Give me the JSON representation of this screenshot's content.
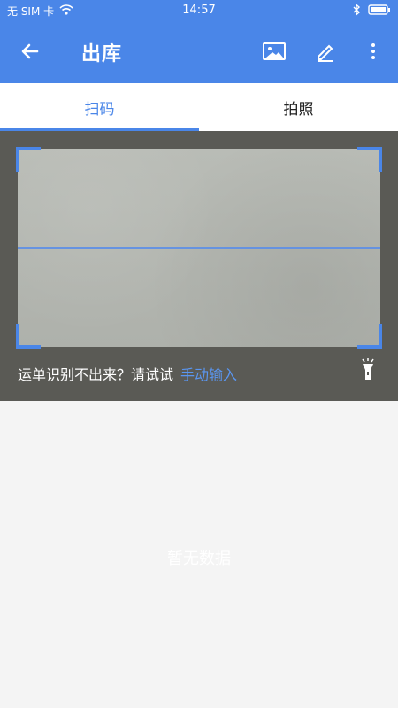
{
  "status_bar": {
    "carrier": "无 SIM 卡",
    "time": "14:57",
    "icons": [
      "wifi-icon",
      "bluetooth-icon",
      "battery-icon"
    ]
  },
  "app_bar": {
    "title": "出库",
    "back_icon": "arrow-left-icon",
    "actions": [
      "image-icon",
      "pencil-icon",
      "more-vert-icon"
    ]
  },
  "tabs": [
    {
      "label": "扫码",
      "active": true
    },
    {
      "label": "拍照",
      "active": false
    }
  ],
  "scanner": {
    "hint_text": "运单识别不出来？请试试",
    "manual_link": "手动输入",
    "torch_icon": "flashlight-icon"
  },
  "empty_state": {
    "text": "暂无数据"
  },
  "colors": {
    "primary": "#4a86e8",
    "link": "#5a96f0",
    "scanner_bg": "#5a5a55",
    "page_bg": "#f4f4f4"
  }
}
